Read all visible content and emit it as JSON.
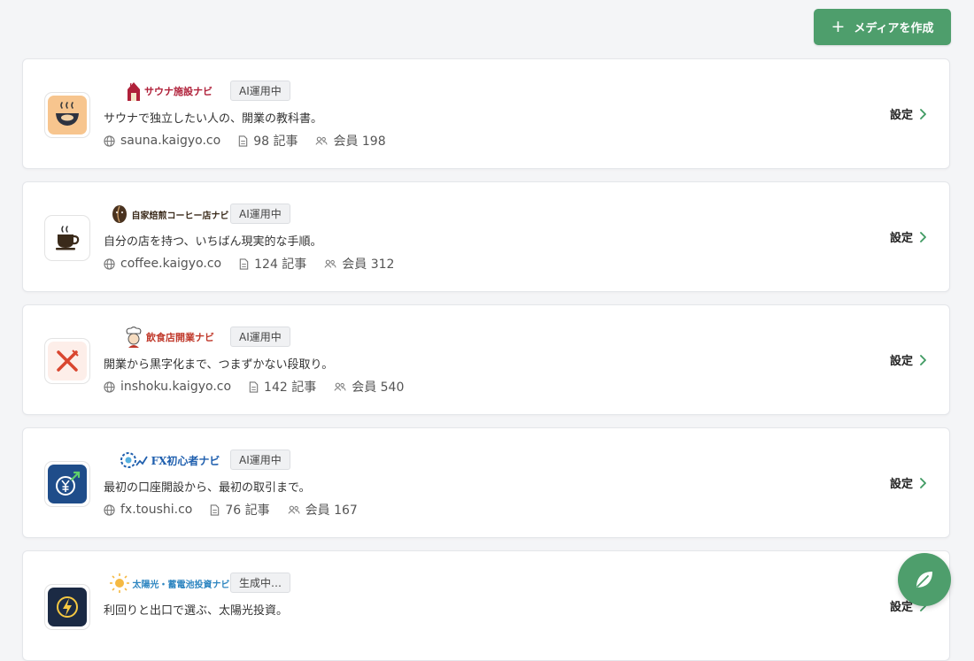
{
  "toolbar": {
    "create_label": "メディアを作成"
  },
  "media": [
    {
      "logo_text": "サウナ施設ナビ",
      "logo_color": "#b0213a",
      "badge": "AI運用中",
      "tagline": "サウナで独立したい人の、開業の教科書。",
      "domain": "sauna.kaigyo.co",
      "articles": "98 記事",
      "members": "会員 198",
      "setting": "設定",
      "icon": "sauna-bowl-icon"
    },
    {
      "logo_text": "自家焙煎コーヒー店ナビ",
      "logo_color": "#3a2a1a",
      "badge": "AI運用中",
      "tagline": "自分の店を持つ、いちばん現実的な手順。",
      "domain": "coffee.kaigyo.co",
      "articles": "124 記事",
      "members": "会員 312",
      "setting": "設定",
      "icon": "coffee-cup-icon"
    },
    {
      "logo_text": "飲食店開業ナビ",
      "logo_color": "#c0392b",
      "badge": "AI運用中",
      "tagline": "開業から黒字化まで、つまずかない段取り。",
      "domain": "inshoku.kaigyo.co",
      "articles": "142 記事",
      "members": "会員 540",
      "setting": "設定",
      "icon": "fork-knife-icon"
    },
    {
      "logo_text": "FX初心者ナビ",
      "logo_color": "#1f5fae",
      "badge": "AI運用中",
      "tagline": "最初の口座開設から、最初の取引まで。",
      "domain": "fx.toushi.co",
      "articles": "76 記事",
      "members": "会員 167",
      "setting": "設定",
      "icon": "yen-growth-icon"
    },
    {
      "logo_text": "太陽光・蓄電池投資ナビ",
      "logo_color": "#2e86c1",
      "badge": "生成中…",
      "tagline": "利回りと出口で選ぶ、太陽光投資。",
      "domain": "",
      "articles": "",
      "members": "",
      "setting": "設定",
      "icon": "lightning-icon"
    }
  ]
}
